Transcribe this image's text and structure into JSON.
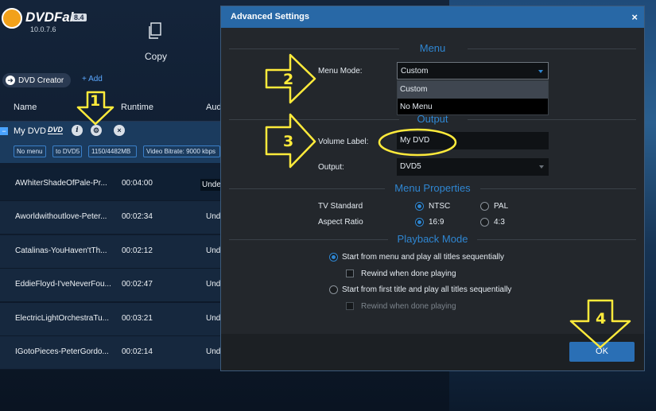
{
  "app": {
    "logo_text": "DVDFab",
    "version_badge": "8.4",
    "version": "10.0.7.6",
    "copy_label": "Copy",
    "creator_label": "DVD Creator",
    "add_label": "+ Add"
  },
  "columns": {
    "name": "Name",
    "runtime": "Runtime",
    "audio": "Audi"
  },
  "source": {
    "title": "My DVD",
    "chips": [
      "No menu",
      "to DVD5",
      "1150/4482MB",
      "Video Bitrate: 9000 kbps"
    ]
  },
  "rows": [
    {
      "name": "AWhiterShadeOfPale-Pr...",
      "duration": "00:04:00",
      "audio": "Unde"
    },
    {
      "name": "Aworldwithoutlove-Peter...",
      "duration": "00:02:34",
      "audio": "Und"
    },
    {
      "name": "Catalinas-YouHaven'tTh...",
      "duration": "00:02:12",
      "audio": "Und"
    },
    {
      "name": "EddieFloyd-I'veNeverFou...",
      "duration": "00:02:47",
      "audio": "Und"
    },
    {
      "name": "ElectricLightOrchestraTu...",
      "duration": "00:03:21",
      "audio": "Und"
    },
    {
      "name": "IGotoPieces-PeterGordo...",
      "duration": "00:02:14",
      "audio": "Und"
    }
  ],
  "callouts": [
    "1",
    "2",
    "3",
    "4"
  ],
  "dialog": {
    "title": "Advanced Settings",
    "close": "×",
    "menu_section": "Menu",
    "menu_mode_label": "Menu Mode:",
    "menu_mode_value": "Custom",
    "menu_mode_options": [
      "Custom",
      "No Menu"
    ],
    "output_section": "Output",
    "volume_label_label": "Volume Label:",
    "volume_label_value": "My DVD",
    "output_label": "Output:",
    "output_value": "DVD5",
    "menu_properties_section": "Menu Properties",
    "tv_standard_label": "TV Standard",
    "tv_ntsc": "NTSC",
    "tv_pal": "PAL",
    "aspect_label": "Aspect Ratio",
    "aspect_169": "16:9",
    "aspect_43": "4:3",
    "playback_section": "Playback Mode",
    "pb_start_menu": "Start from menu and play all titles sequentially",
    "pb_rewind1": "Rewind when done playing",
    "pb_start_title": "Start from first title and play all titles sequentially",
    "pb_rewind2": "Rewind when done playing",
    "ok_label": "OK"
  },
  "colors": {
    "accent": "#2f86d1",
    "title_bar": "#2868a6",
    "callout": "#ffeb3b"
  }
}
